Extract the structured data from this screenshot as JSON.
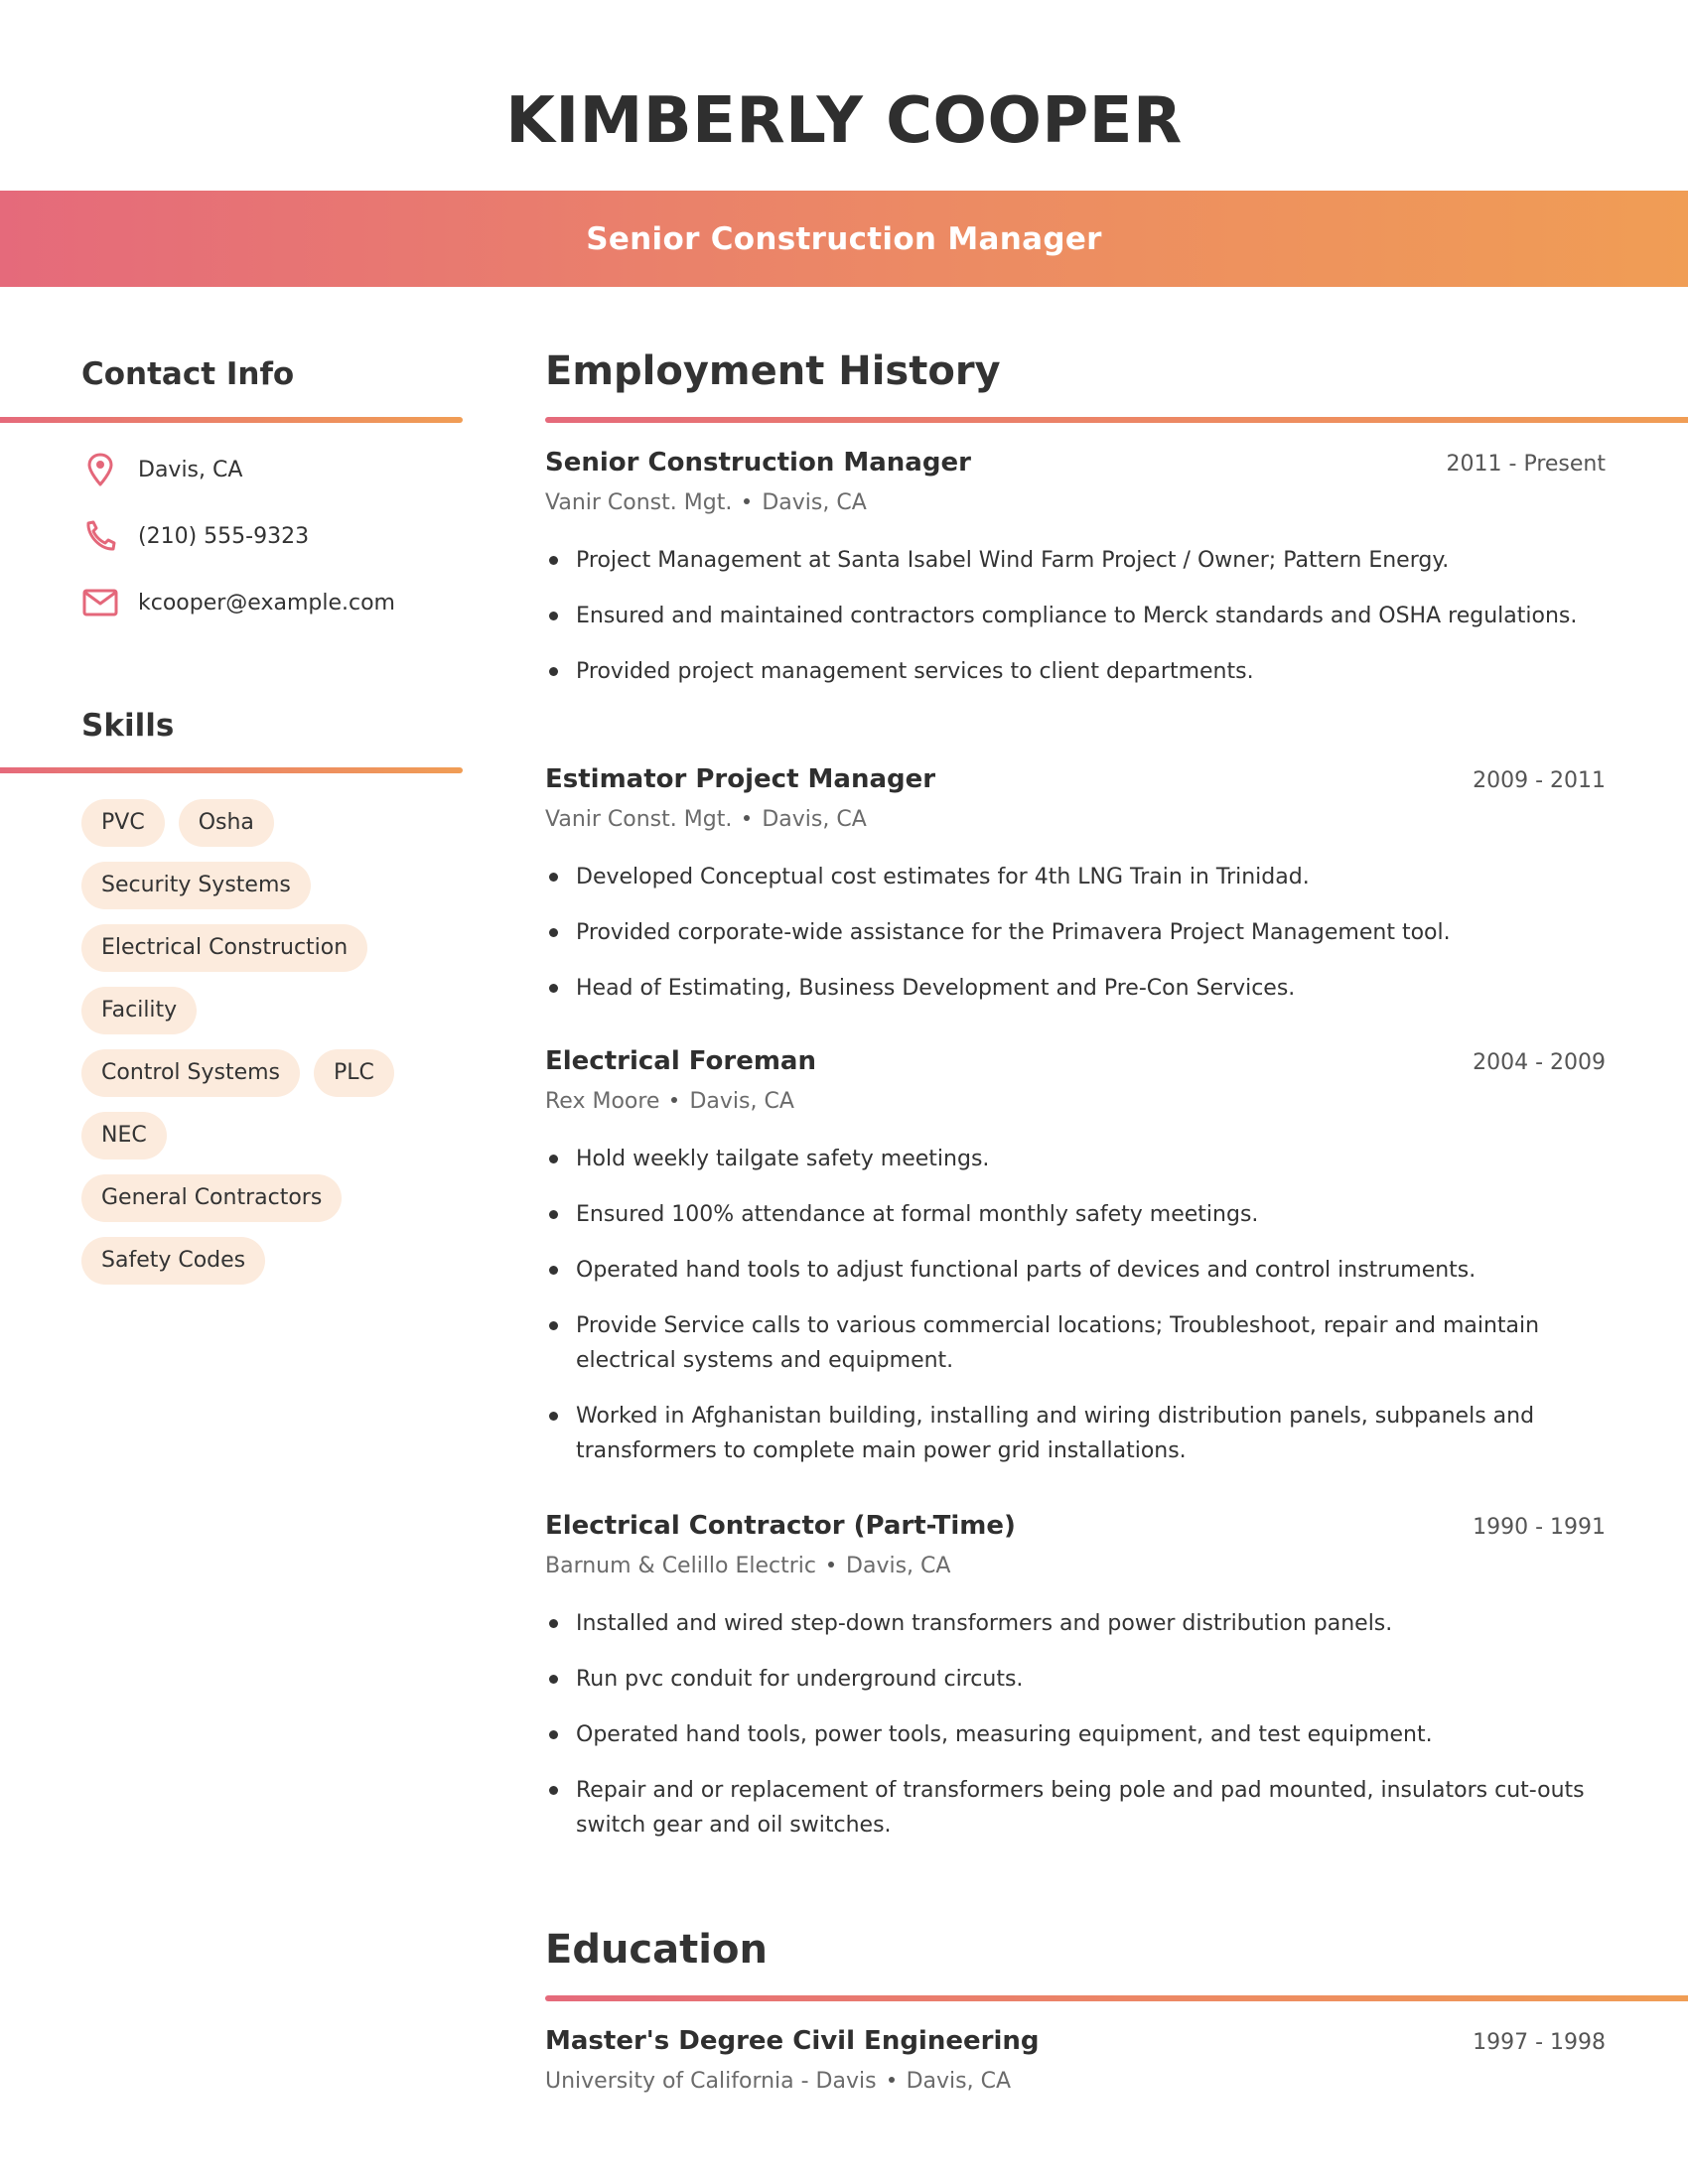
{
  "header": {
    "name": "KIMBERLY COOPER",
    "title": "Senior Construction Manager"
  },
  "colors": {
    "gradient_start": "#E56A7B",
    "gradient_end": "#F09D55",
    "tag_background": "#FCEBDD",
    "icon": "#E4677A"
  },
  "sidebar": {
    "contact_heading": "Contact Info",
    "contact": [
      {
        "icon": "map-pin-icon",
        "text": "Davis, CA"
      },
      {
        "icon": "phone-icon",
        "text": "(210) 555-9323"
      },
      {
        "icon": "mail-icon",
        "text": "kcooper@example.com"
      }
    ],
    "skills_heading": "Skills",
    "skills": [
      "PVC",
      "Osha",
      "Security Systems",
      "Electrical Construction",
      "Facility",
      "Control Systems",
      "PLC",
      "NEC",
      "General Contractors",
      "Safety Codes"
    ]
  },
  "employment": {
    "heading": "Employment History",
    "jobs": [
      {
        "title": "Senior Construction Manager",
        "dates": "2011 - Present",
        "company": "Vanir Const. Mgt.",
        "location": "Davis, CA",
        "bullets": [
          "Project Management at Santa Isabel Wind Farm Project / Owner; Pattern Energy.",
          "Ensured and maintained contractors compliance to Merck standards and OSHA regulations.",
          "Provided project management services to client departments."
        ]
      },
      {
        "title": "Estimator Project Manager",
        "dates": "2009 - 2011",
        "company": "Vanir Const. Mgt.",
        "location": "Davis, CA",
        "bullets": [
          "Developed Conceptual cost estimates for 4th LNG Train in Trinidad.",
          "Provided corporate-wide assistance for the Primavera Project Management tool.",
          "Head of Estimating, Business Development and Pre-Con Services."
        ]
      },
      {
        "title": "Electrical Foreman",
        "dates": "2004 - 2009",
        "company": "Rex Moore",
        "location": "Davis, CA",
        "bullets": [
          "Hold weekly tailgate safety meetings.",
          "Ensured 100% attendance at formal monthly safety meetings.",
          "Operated hand tools to adjust functional parts of devices and control instruments.",
          "Provide Service calls to various commercial locations; Troubleshoot, repair and maintain electrical systems and equipment.",
          "Worked in Afghanistan building, installing and wiring distribution panels, subpanels and transformers to complete main power grid installations."
        ]
      },
      {
        "title": "Electrical Contractor (Part-Time)",
        "dates": "1990 - 1991",
        "company": "Barnum & Celillo Electric",
        "location": "Davis, CA",
        "bullets": [
          "Installed and wired step-down transformers and power distribution panels.",
          "Run pvc conduit for underground circuts.",
          "Operated hand tools, power tools, measuring equipment, and test equipment.",
          "Repair and or replacement of transformers being pole and pad mounted, insulators cut-outs switch gear and oil switches."
        ]
      }
    ]
  },
  "education": {
    "heading": "Education",
    "items": [
      {
        "degree": "Master's Degree Civil Engineering",
        "dates": "1997 - 1998",
        "school": "University of California - Davis",
        "location": "Davis, CA"
      }
    ]
  }
}
